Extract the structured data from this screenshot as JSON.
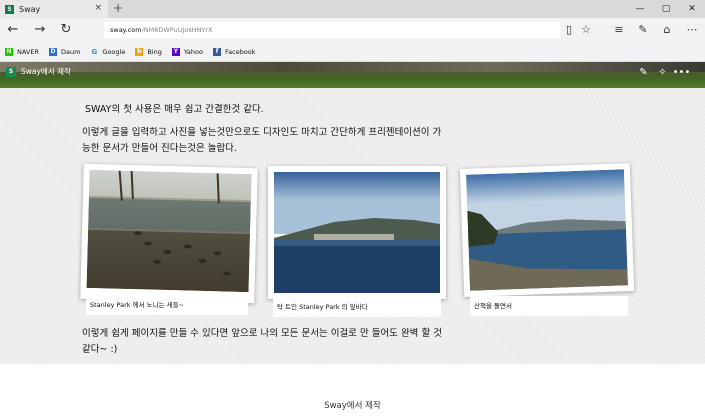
{
  "browser": {
    "tab_title": "Sway",
    "tab_close": "×",
    "new_tab": "+",
    "address": {
      "host": "sway.com",
      "path": "/NM6DWPuUJosHNYrX"
    },
    "window_controls": [
      "—",
      "▢",
      "✕"
    ],
    "nav_icons": [
      "back-icon",
      "forward-icon",
      "refresh-icon"
    ],
    "favorites": [
      {
        "label": "NAVER",
        "icon": "N",
        "color": "#1ec800"
      },
      {
        "label": "Daum",
        "icon": "D",
        "color": "#2b6fd6"
      },
      {
        "label": "Google",
        "icon": "G",
        "color": "#ffffff"
      },
      {
        "label": "Bing",
        "icon": "b",
        "color": "#f0a800"
      },
      {
        "label": "Yahoo",
        "icon": "Y",
        "color": "#6001d2"
      },
      {
        "label": "Facebook",
        "icon": "f",
        "color": "#3b5998"
      }
    ]
  },
  "sway": {
    "brand_label": "Sway에서 제작",
    "paragraph1": "SWAY의 첫 사용은 매우 쉽고 간결한것 같다.",
    "paragraph2": "이렇게 글을 입력하고 사진을 넣는것만으로도 디자인도 마치고 간단하게 프리젠테이션이 가능한 문서가 만들어 진다는것은 놀랍다.",
    "paragraph3": "이렇게 쉽게 페이지를 만들 수 있다면 앞으로 나의 모든 문서는 이걸로 만 들어도 완벽 할 것 같다~ :)",
    "photos": [
      {
        "caption": "Stanley Park 에서 노니는 새들~",
        "subject": "ducks-by-pond"
      },
      {
        "caption": "탁 트인 Stanley Park 의 앞바다",
        "subject": "bay-and-city-skyline"
      },
      {
        "caption": "산책을 돌면서",
        "subject": "shoreline-walk"
      }
    ],
    "footer_text": "Sway에서 제작"
  },
  "colors": {
    "sway_green": "#1a8a55",
    "content_bg": "#ececec"
  }
}
